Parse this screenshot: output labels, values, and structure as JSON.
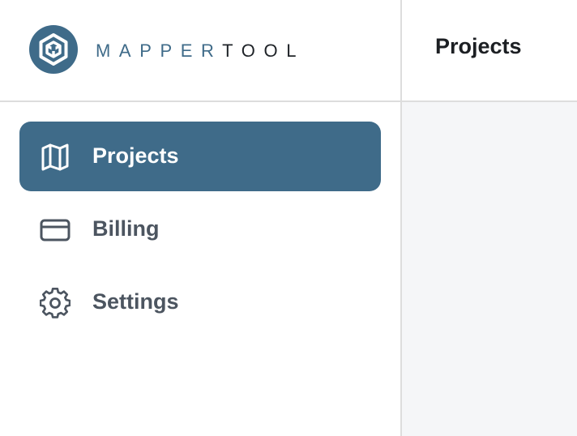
{
  "brand": {
    "name_part_a": "MAPPER",
    "name_part_b": "TOOL",
    "logo_icon": "cube-hexagon-logo-icon",
    "accent_color": "#3f6b89"
  },
  "header": {
    "title": "Projects"
  },
  "sidebar": {
    "items": [
      {
        "label": "Projects",
        "icon": "map-icon",
        "active": true
      },
      {
        "label": "Billing",
        "icon": "credit-card-icon",
        "active": false
      },
      {
        "label": "Settings",
        "icon": "gear-icon",
        "active": false
      }
    ]
  },
  "colors": {
    "active_bg": "#3f6b89",
    "text_muted": "#4c5560",
    "content_bg": "#f5f6f8",
    "divider": "#dddddd"
  }
}
